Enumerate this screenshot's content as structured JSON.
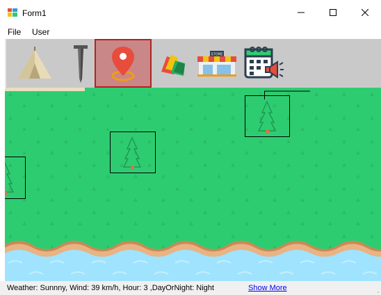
{
  "window": {
    "title": "Form1",
    "icon": "winforms-app-icon",
    "controls": {
      "minimize": "minimize-icon",
      "maximize": "maximize-icon",
      "close": "close-icon"
    }
  },
  "menu": {
    "items": [
      "File",
      "User"
    ]
  },
  "toolbar": {
    "selected_tool": "location-pin",
    "tools": [
      {
        "icon": "tent-icon"
      },
      {
        "icon": "nail-icon"
      },
      {
        "icon": "location-pin-icon"
      },
      {
        "icon": "bells-icon"
      },
      {
        "icon": "store-icon",
        "label": "STORE"
      },
      {
        "icon": "calendar-announcement-icon"
      }
    ]
  },
  "map": {
    "terrain": "grass",
    "objects": [
      {
        "icon": "pine-tree-icon"
      },
      {
        "icon": "pine-tree-icon"
      },
      {
        "icon": "pine-tree-icon"
      }
    ]
  },
  "status": {
    "text": "Weather: Sunnny, Wind: 39 km/h, Hour: 3 ,DayOrNight: Night",
    "link": "Show More"
  },
  "colors": {
    "grass": "#2ecc71",
    "water": "#9fe3ff",
    "sand": "#e9b383",
    "toolbar": "#c9c9c9",
    "selection": "#b22222"
  }
}
